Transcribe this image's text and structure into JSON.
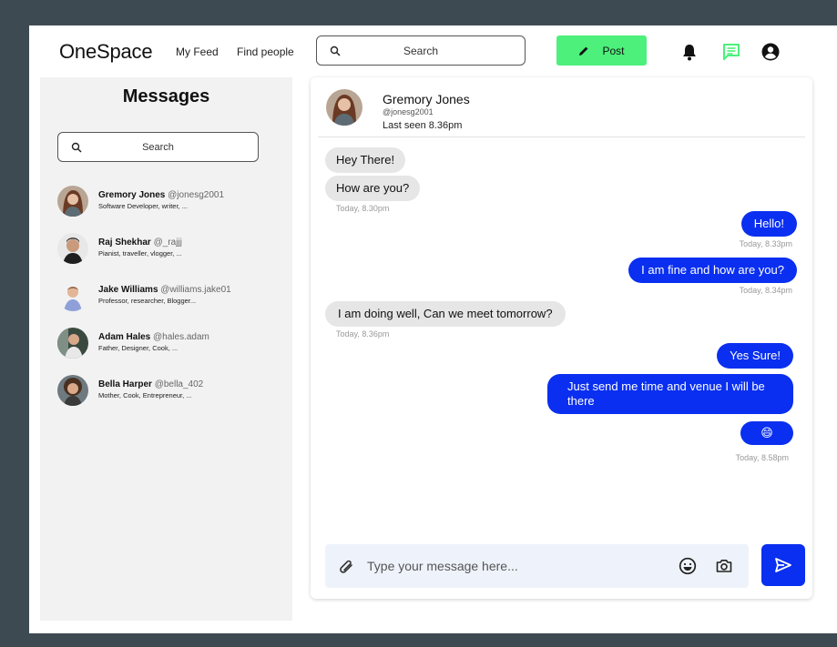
{
  "app": {
    "logo": "OneSpace",
    "nav": {
      "feed": "My Feed",
      "find": "Find people"
    },
    "search_placeholder": "Search",
    "post_label": "Post",
    "icons": {
      "notifications": "bell-icon",
      "messages": "chat-icon",
      "profile": "user-circle-icon"
    },
    "colors": {
      "post_button": "#4cf07a",
      "primary_blue": "#0a2ff0",
      "active_icon": "#4cf07a"
    }
  },
  "sidebar": {
    "title": "Messages",
    "search_placeholder": "Search",
    "contacts": [
      {
        "name": "Gremory Jones",
        "handle": "@jonesg2001",
        "bio": "Software Developer, writer, ..."
      },
      {
        "name": "Raj Shekhar",
        "handle": "@_rajjj",
        "bio": "Pianist, traveller, vlogger, ..."
      },
      {
        "name": "Jake Williams",
        "handle": "@williams.jake01",
        "bio": "Professor, researcher, Blogger..."
      },
      {
        "name": "Adam Hales",
        "handle": "@hales.adam",
        "bio": "Father, Designer, Cook, ..."
      },
      {
        "name": "Bella Harper",
        "handle": "@bella_402",
        "bio": "Mother, Cook, Entrepreneur, ..."
      }
    ]
  },
  "chat": {
    "name": "Gremory Jones",
    "handle": "@jonesg2001",
    "last_seen": "Last seen 8.36pm",
    "messages": [
      {
        "dir": "in",
        "text": "Hey There!"
      },
      {
        "dir": "in",
        "text": "How are you?"
      },
      {
        "dir": "ts_in",
        "text": "Today, 8.30pm"
      },
      {
        "dir": "out",
        "text": "Hello!"
      },
      {
        "dir": "ts_out",
        "text": "Today, 8.33pm"
      },
      {
        "dir": "out",
        "text": "I am fine and how are you?"
      },
      {
        "dir": "ts_out",
        "text": "Today, 8.34pm"
      },
      {
        "dir": "in",
        "text": "I am doing well, Can we meet tomorrow?"
      },
      {
        "dir": "ts_in",
        "text": "Today, 8.36pm"
      },
      {
        "dir": "out",
        "text": "Yes Sure!"
      },
      {
        "dir": "out",
        "text": "Just send me time and venue I will be there"
      },
      {
        "dir": "out",
        "text": "😄"
      },
      {
        "dir": "ts_out",
        "text": "Today, 8.58pm"
      }
    ],
    "composer_placeholder": "Type your message here..."
  }
}
